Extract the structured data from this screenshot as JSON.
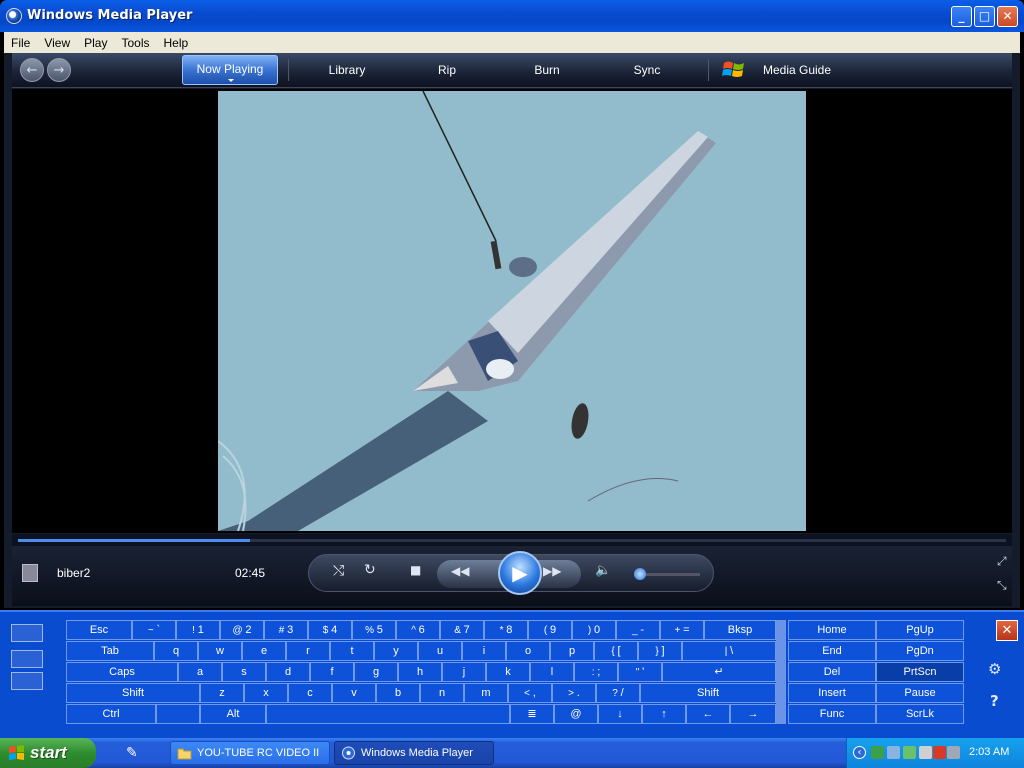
{
  "window": {
    "title": "Windows Media Player"
  },
  "titlebar_buttons": {
    "minimize": "_",
    "maximize": "□",
    "close": "✕"
  },
  "menu": [
    "File",
    "View",
    "Play",
    "Tools",
    "Help"
  ],
  "nav": {
    "tabs": [
      "Now Playing",
      "Library",
      "Rip",
      "Burn",
      "Sync",
      "Media Guide"
    ],
    "back": "←",
    "forward": "→"
  },
  "now_playing": {
    "title": "biber2",
    "time": "02:45",
    "progress": 0.235
  },
  "controls": {
    "shuffle": "⤭",
    "repeat": "↻",
    "stop": "■",
    "rewind": "◀◀",
    "play": "▶",
    "forward": "▶▶",
    "mute": "🔈",
    "volume": 0.05,
    "fullscreen": "⤢",
    "compact": "⤡"
  },
  "osk": {
    "close": "✕",
    "settings": "⚙",
    "help": "?",
    "rows": [
      [
        [
          "Esc"
        ],
        [
          "~",
          "`"
        ],
        [
          "!",
          "1"
        ],
        [
          "@",
          "2"
        ],
        [
          "#",
          "3"
        ],
        [
          "$",
          "4"
        ],
        [
          "%",
          "5"
        ],
        [
          "^",
          "6"
        ],
        [
          "&",
          "7"
        ],
        [
          "*",
          "8"
        ],
        [
          "(",
          "9"
        ],
        [
          ")",
          "0"
        ],
        [
          "_",
          "-"
        ],
        [
          "+",
          "="
        ],
        [
          "Bksp"
        ]
      ],
      [
        [
          "Tab"
        ],
        [
          "q"
        ],
        [
          "w"
        ],
        [
          "e"
        ],
        [
          "r"
        ],
        [
          "t"
        ],
        [
          "y"
        ],
        [
          "u"
        ],
        [
          "i"
        ],
        [
          "o"
        ],
        [
          "p"
        ],
        [
          "{",
          "["
        ],
        [
          "}",
          "]"
        ],
        [
          "|",
          "\\"
        ]
      ],
      [
        [
          "Caps"
        ],
        [
          "a"
        ],
        [
          "s"
        ],
        [
          "d"
        ],
        [
          "f"
        ],
        [
          "g"
        ],
        [
          "h"
        ],
        [
          "j"
        ],
        [
          "k"
        ],
        [
          "l"
        ],
        [
          ":",
          ";"
        ],
        [
          "\"",
          "'"
        ],
        [
          "↵"
        ]
      ],
      [
        [
          "Shift"
        ],
        [
          "z"
        ],
        [
          "x"
        ],
        [
          "c"
        ],
        [
          "v"
        ],
        [
          "b"
        ],
        [
          "n"
        ],
        [
          "m"
        ],
        [
          "<",
          ","
        ],
        [
          ">",
          "."
        ],
        [
          "?",
          "/"
        ],
        [
          "Shift"
        ]
      ],
      [
        [
          "Ctrl"
        ],
        [
          ""
        ],
        [
          "Alt"
        ],
        [
          ""
        ],
        [
          "≣"
        ],
        [
          "@"
        ],
        [
          "↓"
        ],
        [
          "↑"
        ],
        [
          "←"
        ],
        [
          "→"
        ]
      ]
    ],
    "nav_keys": [
      [
        "Home",
        "PgUp"
      ],
      [
        "End",
        "PgDn"
      ],
      [
        "Del",
        "PrtScn"
      ],
      [
        "Insert",
        "Pause"
      ],
      [
        "Func",
        "ScrLk"
      ]
    ]
  },
  "taskbar": {
    "start": "start",
    "items": [
      "YOU-TUBE RC VIDEO II",
      "Windows Media Player"
    ],
    "clock": "2:03 AM",
    "tray_toggle": "‹"
  }
}
